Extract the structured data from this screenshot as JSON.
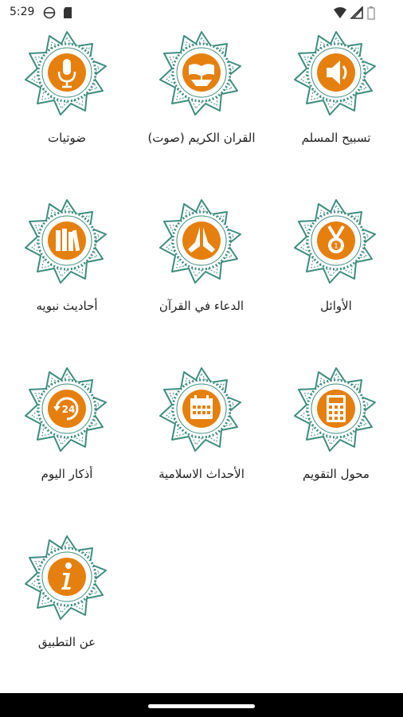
{
  "status_bar": {
    "time": "5:29",
    "icons": [
      "vpn-icon",
      "sd-card-icon",
      "wifi-icon",
      "signal-icon",
      "battery-icon"
    ]
  },
  "colors": {
    "teal": "#3f8c7f",
    "orange": "#e5800f",
    "background": "#ffffff",
    "text": "#222222"
  },
  "tiles": [
    {
      "label": "تسبيح المسلم",
      "icon": "speaker-icon"
    },
    {
      "label": "القران الكريم (صوت)",
      "icon": "quran-stand-icon"
    },
    {
      "label": "ضوتيات",
      "icon": "microphone-icon"
    },
    {
      "label": "الأوائل",
      "icon": "medal-icon"
    },
    {
      "label": "الدعاء في القرآن",
      "icon": "praying-hands-icon"
    },
    {
      "label": "أحاديث نبويه",
      "icon": "books-icon"
    },
    {
      "label": "محول التقويم",
      "icon": "calculator-icon"
    },
    {
      "label": "الأحداث الاسلامية",
      "icon": "calendar-icon"
    },
    {
      "label": "أذكار اليوم",
      "icon": "clock-24-icon"
    },
    {
      "label": "عن التطبيق",
      "icon": "info-icon"
    }
  ]
}
